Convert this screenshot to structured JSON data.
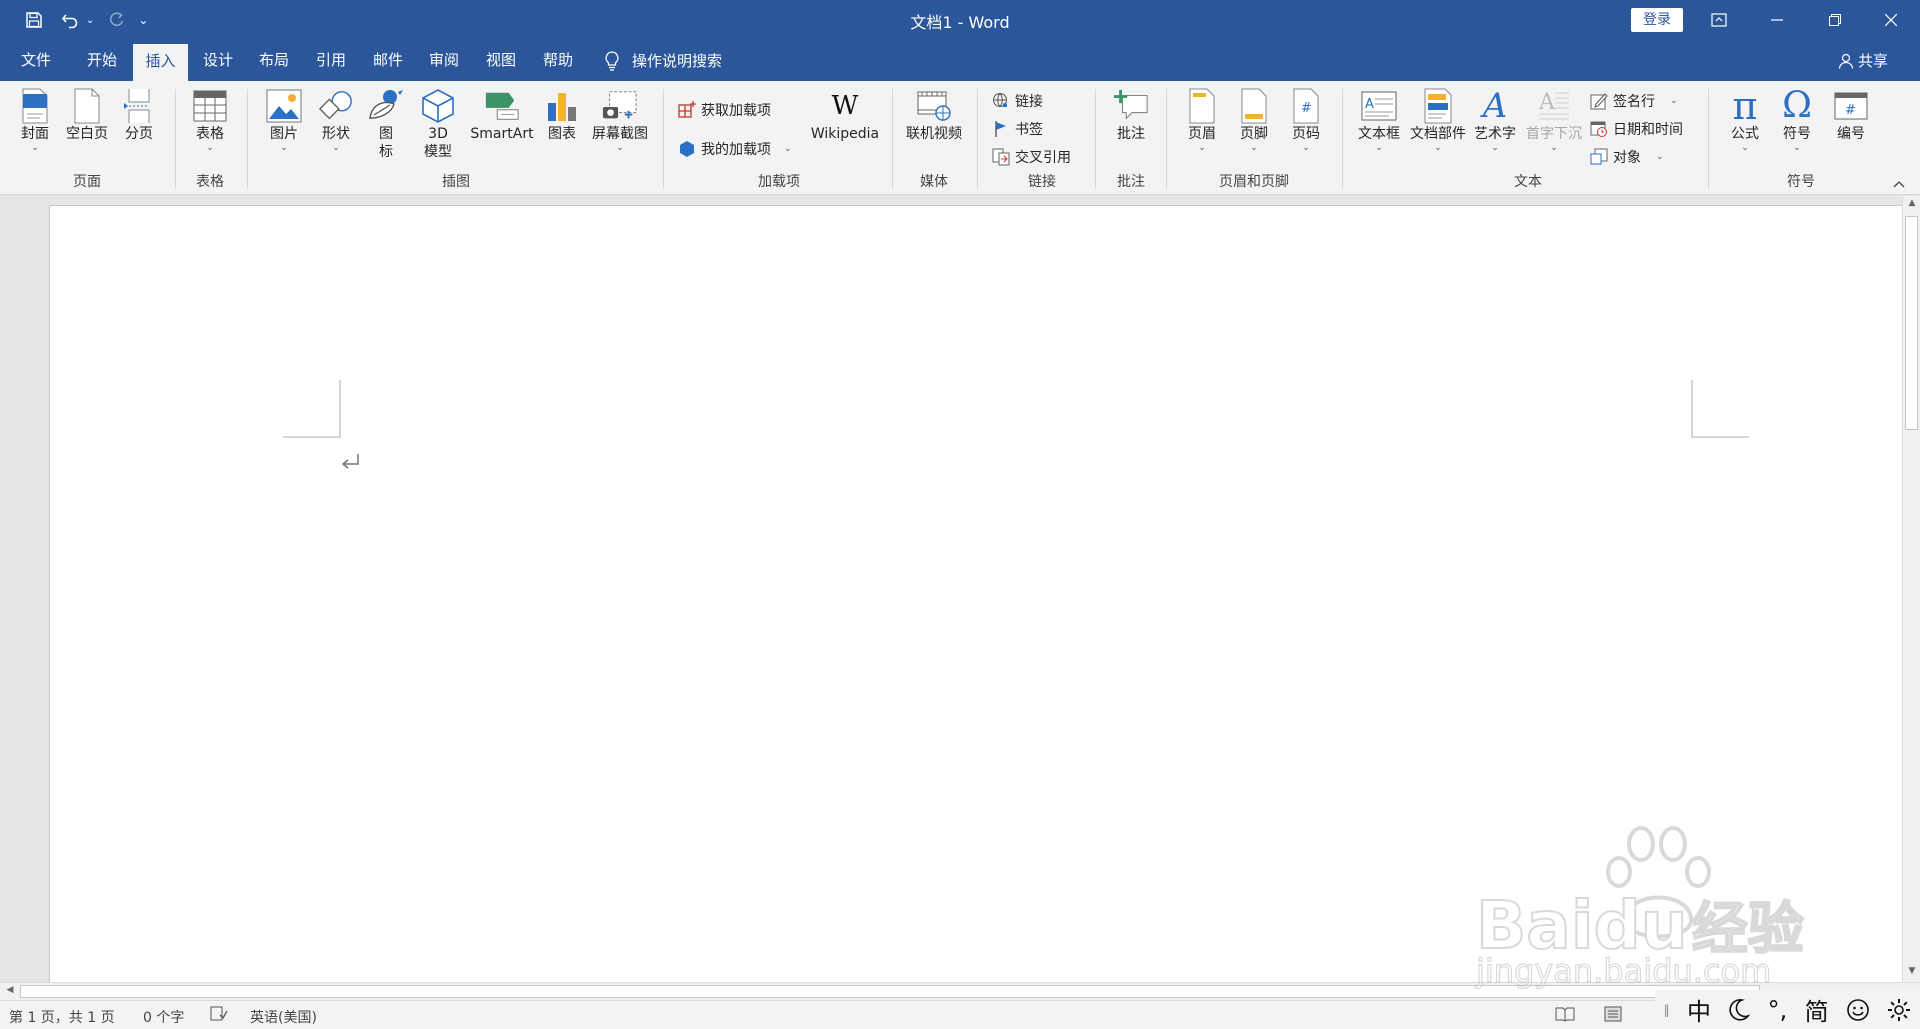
{
  "title": "文档1  -  Word",
  "login": "登录",
  "tabs": [
    "文件",
    "开始",
    "插入",
    "设计",
    "布局",
    "引用",
    "邮件",
    "审阅",
    "视图",
    "帮助"
  ],
  "active_tab": "插入",
  "tellme": "操作说明搜索",
  "share": "共享",
  "ribbon": {
    "pages": {
      "cover": "封面",
      "blank": "空白页",
      "break": "分页",
      "label": "页面"
    },
    "tables": {
      "table": "表格",
      "label": "表格"
    },
    "illustrations": {
      "picture": "图片",
      "shapes": "形状",
      "icons_line1": "图",
      "icons_line2": "标",
      "model_line1": "3D",
      "model_line2": "模型",
      "smartart": "SmartArt",
      "chart": "图表",
      "screenshot": "屏幕截图",
      "label": "插图"
    },
    "addins": {
      "get": "获取加载项",
      "mine": "我的加载项",
      "wikipedia": "Wikipedia",
      "label": "加载项"
    },
    "media": {
      "video": "联机视频",
      "label": "媒体"
    },
    "links": {
      "link": "链接",
      "bookmark": "书签",
      "crossref": "交叉引用",
      "label": "链接"
    },
    "comments": {
      "comment": "批注",
      "label": "批注"
    },
    "headerfooter": {
      "header": "页眉",
      "footer": "页脚",
      "pagenum": "页码",
      "label": "页眉和页脚"
    },
    "text": {
      "textbox": "文本框",
      "quickparts": "文档部件",
      "wordart": "艺术字",
      "dropcap": "首字下沉",
      "signature": "签名行",
      "datetime": "日期和时间",
      "object": "对象",
      "label": "文本"
    },
    "symbols": {
      "equation": "公式",
      "symbol": "符号",
      "numbering": "编号",
      "label": "符号"
    }
  },
  "status": {
    "page": "第 1 页，共 1 页",
    "words": "0 个字",
    "language": "英语(美国)"
  },
  "ime": {
    "mode": "中",
    "punct": "°,",
    "charset": "简"
  },
  "watermark": {
    "brand": "Baidu",
    "cn": "经验",
    "url": "jingyan.baidu.com"
  },
  "colors": {
    "brand": "#2b579a",
    "ribbon": "#f3f3f3",
    "canvas": "#e6e6e6"
  }
}
